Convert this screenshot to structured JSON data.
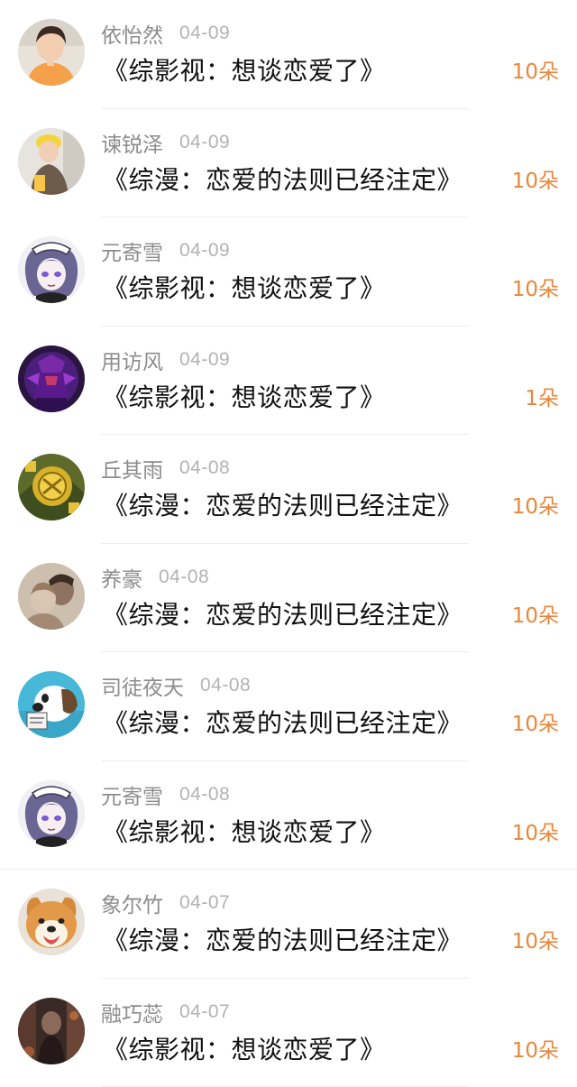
{
  "colors": {
    "name": "#8c8c8c",
    "date": "#b3b3b3",
    "title": "#111111",
    "gift": "#e8863a",
    "divider": "#efefef"
  },
  "rows": [
    {
      "name": "依怡然",
      "date": "04-09",
      "title": "《综影视：想谈恋爱了》",
      "gift": "10朵",
      "avatar": "avatar-photo-girl-orange"
    },
    {
      "name": "谏锐泽",
      "date": "04-09",
      "title": "《综漫：恋爱的法则已经注定》",
      "gift": "10朵",
      "avatar": "avatar-photo-girl-yellow-hat"
    },
    {
      "name": "元寄雪",
      "date": "04-09",
      "title": "《综影视：想谈恋爱了》",
      "gift": "10朵",
      "avatar": "avatar-anime-maid"
    },
    {
      "name": "用访风",
      "date": "04-09",
      "title": "《综影视：想谈恋爱了》",
      "gift": "1朵",
      "avatar": "avatar-purple-warrior"
    },
    {
      "name": "丘其雨",
      "date": "04-08",
      "title": "《综漫：恋爱的法则已经注定》",
      "gift": "10朵",
      "avatar": "avatar-gold-emblem"
    },
    {
      "name": "养豪",
      "date": "04-08",
      "title": "《综漫：恋爱的法则已经注定》",
      "gift": "10朵",
      "avatar": "avatar-sepia-couple"
    },
    {
      "name": "司徒夜天",
      "date": "04-08",
      "title": "《综漫：恋爱的法则已经注定》",
      "gift": "10朵",
      "avatar": "avatar-cartoon-dog"
    },
    {
      "name": "元寄雪",
      "date": "04-08",
      "title": "《综影视：想谈恋爱了》",
      "gift": "10朵",
      "avatar": "avatar-anime-maid"
    },
    {
      "name": "象尔竹",
      "date": "04-07",
      "title": "《综漫：恋爱的法则已经注定》",
      "gift": "10朵",
      "avatar": "avatar-shiba-dog"
    },
    {
      "name": "融巧蕊",
      "date": "04-07",
      "title": "《综影视：想谈恋爱了》",
      "gift": "10朵",
      "avatar": "avatar-dark-figure"
    }
  ]
}
